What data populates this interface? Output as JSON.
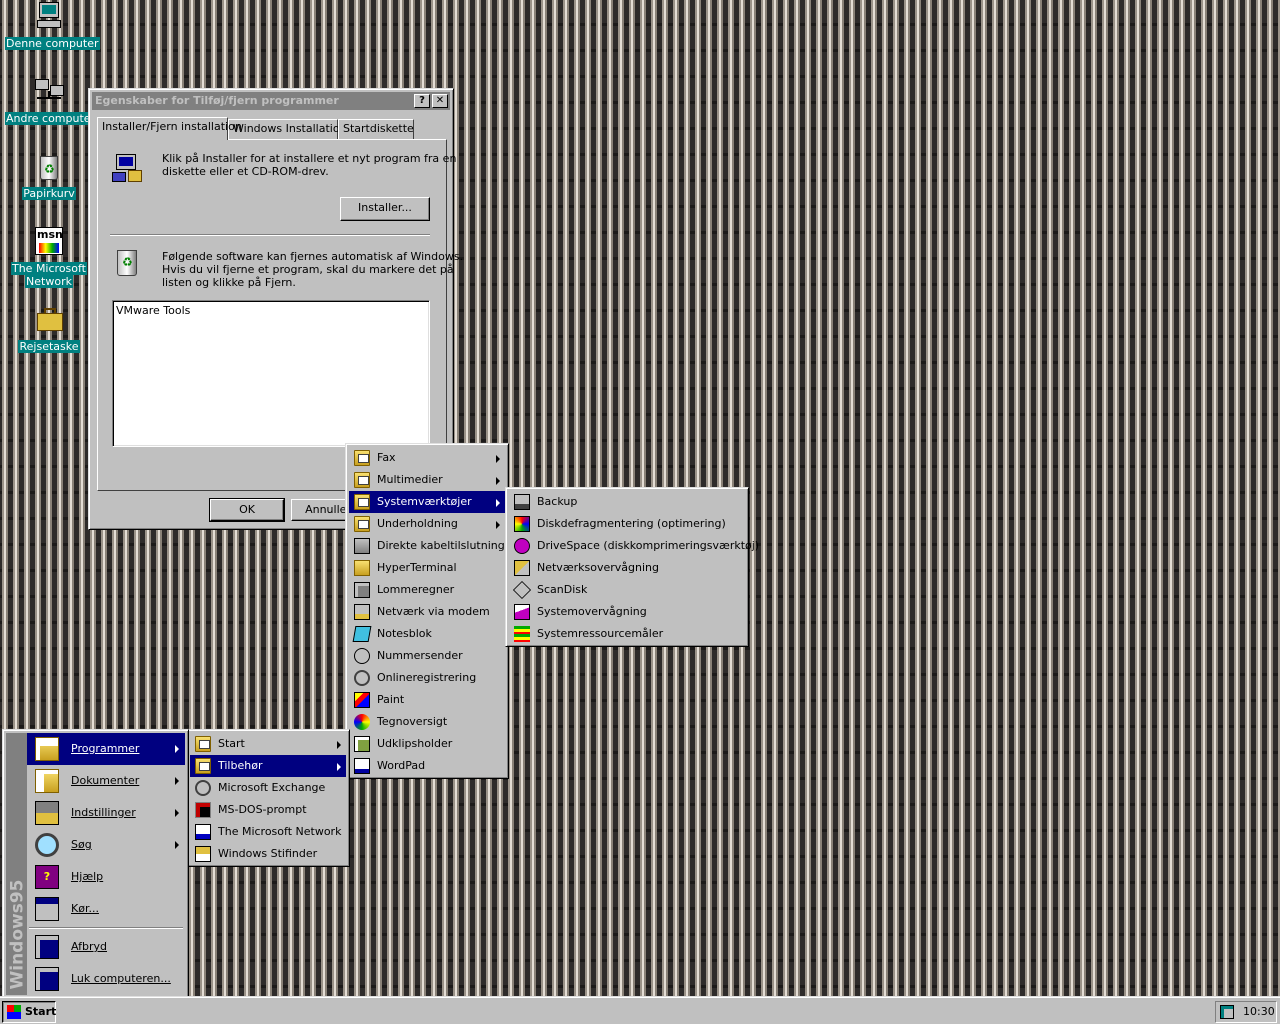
{
  "desktop_icons": [
    {
      "label": "Denne computer",
      "icon": "my-computer-icon"
    },
    {
      "label": "Andre computere",
      "icon": "network-neighborhood-icon"
    },
    {
      "label": "Papirkurv",
      "icon": "recycle-bin-icon"
    },
    {
      "label": "The Microsoft Network",
      "line1": "The Microsoft",
      "line2": "Network",
      "icon": "msn-icon"
    },
    {
      "label": "Rejsetaske",
      "icon": "briefcase-icon"
    }
  ],
  "dialog": {
    "title": "Egenskaber for Tilføj/fjern programmer",
    "help_glyph": "?",
    "close_glyph": "✕",
    "tabs": [
      "Installer/Fjern installation",
      "Windows Installation",
      "Startdiskette"
    ],
    "install_text_1": "Klik på Installer for at installere et nyt program fra en",
    "install_text_2": "diskette eller et CD-ROM-drev.",
    "install_button": "Installer...",
    "remove_text_1": "Følgende software kan fjernes automatisk af Windows.",
    "remove_text_2": "Hvis du vil fjerne et program, skal du markere det på",
    "remove_text_3": "listen og klikke på Fjern.",
    "software_list": [
      "VMware Tools"
    ],
    "ok_button": "OK",
    "cancel_button": "Annuller"
  },
  "start_menu": {
    "banner_text": "Windows95",
    "items": [
      {
        "label": "Programmer",
        "icon": "programs-icon",
        "submenu": true
      },
      {
        "label": "Dokumenter",
        "icon": "documents-icon",
        "submenu": true
      },
      {
        "label": "Indstillinger",
        "icon": "settings-icon",
        "submenu": true
      },
      {
        "label": "Søg",
        "icon": "find-icon",
        "submenu": true
      },
      {
        "label": "Hjælp",
        "icon": "help-book-icon",
        "submenu": false
      },
      {
        "label": "Kør...",
        "icon": "run-icon",
        "submenu": false
      },
      {
        "label": "Afbryd",
        "icon": "log-off-icon",
        "submenu": false
      },
      {
        "label": "Luk computeren...",
        "icon": "shutdown-icon",
        "submenu": false
      }
    ]
  },
  "programs_menu": [
    {
      "label": "Start",
      "icon": "folder-icon",
      "submenu": true
    },
    {
      "label": "Tilbehør",
      "icon": "folder-icon",
      "submenu": true
    },
    {
      "label": "Microsoft Exchange",
      "icon": "exchange-icon",
      "submenu": false
    },
    {
      "label": "MS-DOS-prompt",
      "icon": "msdos-icon",
      "submenu": false
    },
    {
      "label": "The Microsoft Network",
      "icon": "msn-icon",
      "submenu": false
    },
    {
      "label": "Windows Stifinder",
      "icon": "explorer-icon",
      "submenu": false
    }
  ],
  "accessories_menu": [
    {
      "label": "Fax",
      "icon": "folder-icon",
      "submenu": true
    },
    {
      "label": "Multimedier",
      "icon": "folder-icon",
      "submenu": true
    },
    {
      "label": "Systemværktøjer",
      "icon": "folder-icon",
      "submenu": true
    },
    {
      "label": "Underholdning",
      "icon": "folder-icon",
      "submenu": true
    },
    {
      "label": "Direkte kabeltilslutning",
      "icon": "direct-cable-icon",
      "submenu": false
    },
    {
      "label": "HyperTerminal",
      "icon": "folder-icon",
      "submenu": false
    },
    {
      "label": "Lommeregner",
      "icon": "calculator-icon",
      "submenu": false
    },
    {
      "label": "Netværk via modem",
      "icon": "dialup-icon",
      "submenu": false
    },
    {
      "label": "Notesblok",
      "icon": "notepad-icon",
      "submenu": false
    },
    {
      "label": "Nummersender",
      "icon": "phone-dialer-icon",
      "submenu": false
    },
    {
      "label": "Onlineregistrering",
      "icon": "registration-icon",
      "submenu": false
    },
    {
      "label": "Paint",
      "icon": "paint-icon",
      "submenu": false
    },
    {
      "label": "Tegnoversigt",
      "icon": "charmap-icon",
      "submenu": false
    },
    {
      "label": "Udklipsholder",
      "icon": "clipboard-icon",
      "submenu": false
    },
    {
      "label": "WordPad",
      "icon": "wordpad-icon",
      "submenu": false
    }
  ],
  "system_tools_menu": [
    {
      "label": "Backup",
      "icon": "backup-icon"
    },
    {
      "label": "Diskdefragmentering (optimering)",
      "icon": "defrag-icon"
    },
    {
      "label": "DriveSpace (diskkomprimeringsværktøj)",
      "icon": "drivespace-icon"
    },
    {
      "label": "Netværksovervågning",
      "icon": "netwatcher-icon"
    },
    {
      "label": "ScanDisk",
      "icon": "scandisk-icon"
    },
    {
      "label": "Systemovervågning",
      "icon": "sysmonitor-icon"
    },
    {
      "label": "Systemressourcemåler",
      "icon": "resource-meter-icon"
    }
  ],
  "taskbar": {
    "start_label": "Start",
    "clock": "10:30"
  },
  "colors": {
    "desktop": "#2e2b2a",
    "menu_face": "#c0c0c0",
    "highlight": "#000080",
    "desktop_label": "#008080",
    "titlebar_inactive": "#808080"
  }
}
